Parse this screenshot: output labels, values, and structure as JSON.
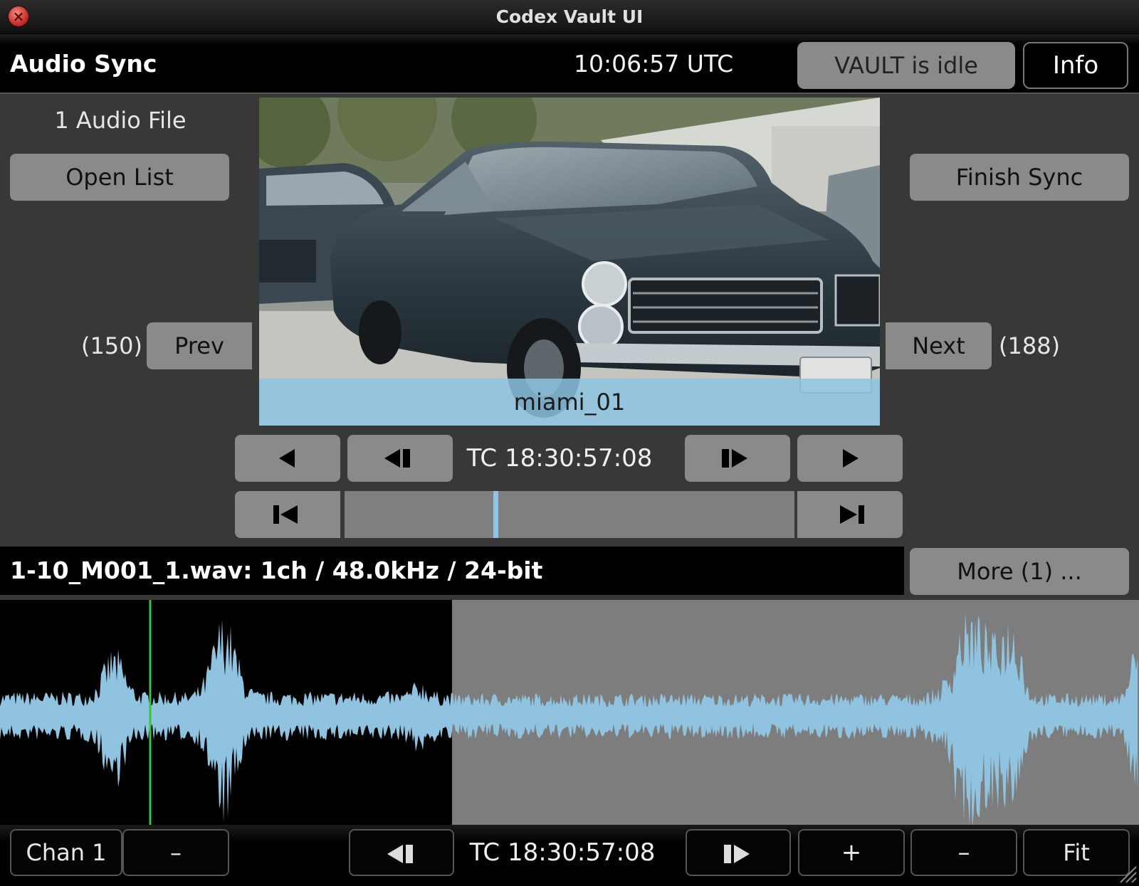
{
  "window": {
    "title": "Codex Vault UI",
    "close_glyph": "×"
  },
  "header": {
    "title": "Audio Sync",
    "clock": "10:06:57 UTC",
    "status": "VAULT is idle",
    "info_label": "Info"
  },
  "left_panel": {
    "file_count": "1 Audio File",
    "open_list_label": "Open List"
  },
  "right_panel": {
    "finish_label": "Finish Sync"
  },
  "preview": {
    "clip_name": "miami_01"
  },
  "navigation": {
    "prev_count": "(150)",
    "prev_label": "Prev",
    "next_label": "Next",
    "next_count": "(188)"
  },
  "transport": {
    "timecode": "TC 18:30:57:08",
    "playhead_position": 0.33
  },
  "audio": {
    "file_info": "1-10_M001_1.wav: 1ch / 48.0kHz / 24-bit",
    "more_label": "More (1) ..."
  },
  "waveform": {
    "sync_fraction": 0.397,
    "cursor_fraction": 0.132
  },
  "bottom": {
    "channel_label": "Chan 1",
    "channel_minus_label": "–",
    "timecode": "TC 18:30:57:08",
    "zoom_in_label": "+",
    "zoom_out_label": "–",
    "fit_label": "Fit"
  },
  "colors": {
    "accent": "#8fc3e0",
    "waveform": "#8fc3e0",
    "cursor": "#39c43a",
    "button": "#8a8a8a",
    "panel": "#383838"
  }
}
